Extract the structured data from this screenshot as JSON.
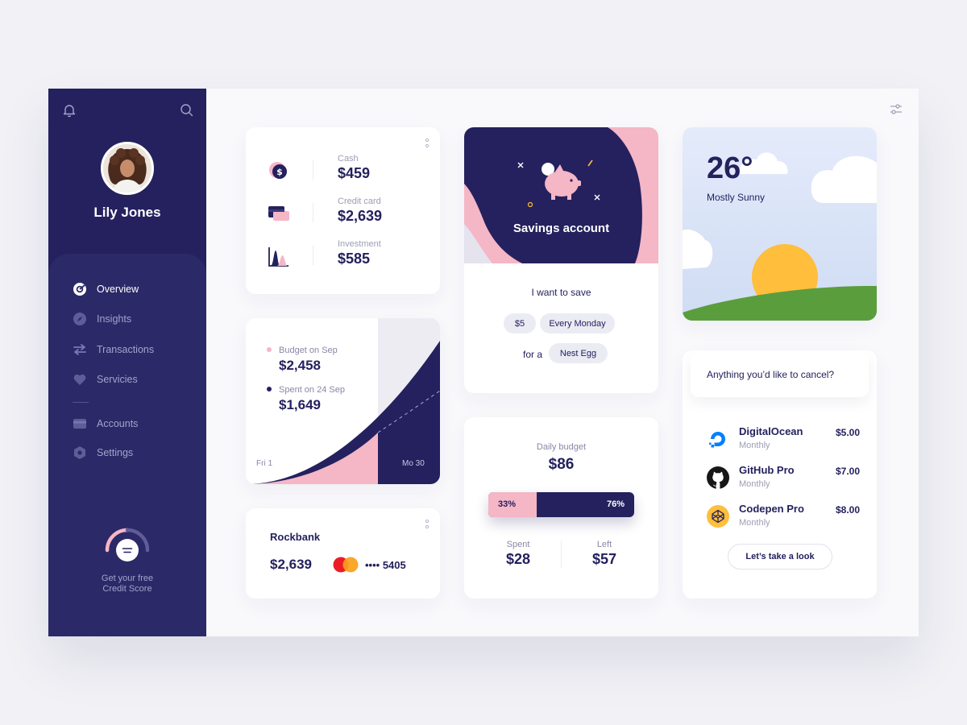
{
  "user": {
    "name": "Lily Jones"
  },
  "nav": {
    "items": [
      {
        "label": "Overview",
        "icon": "overview-icon",
        "active": true
      },
      {
        "label": "Insights",
        "icon": "compass-icon"
      },
      {
        "label": "Transactions",
        "icon": "transfer-icon"
      },
      {
        "label": "Servicies",
        "icon": "heart-icon"
      },
      {
        "label": "Accounts",
        "icon": "wallet-icon"
      },
      {
        "label": "Settings",
        "icon": "gear-icon"
      }
    ]
  },
  "credit_score": {
    "line1": "Get your free",
    "line2": "Credit Score"
  },
  "accounts": [
    {
      "label": "Cash",
      "value": "$459",
      "icon": "dollar-coin-icon"
    },
    {
      "label": "Credit card",
      "value": "$2,639",
      "icon": "credit-card-icon"
    },
    {
      "label": "Investment",
      "value": "$585",
      "icon": "investment-chart-icon"
    }
  ],
  "budget": {
    "budget_label": "Budget on Sep",
    "budget_value": "$2,458",
    "spent_label": "Spent on 24 Sep",
    "spent_value": "$1,649",
    "start_label": "Fri 1",
    "end_label": "Mo 30"
  },
  "rockbank": {
    "name": "Rockbank",
    "balance": "$2,639",
    "card_mask": "•••• 5405"
  },
  "savings": {
    "title": "Savings account",
    "want_text": "I want to save",
    "amount": "$5",
    "frequency": "Every Monday",
    "for_text": "for a",
    "goal": "Nest Egg"
  },
  "daily": {
    "label": "Daily budget",
    "value": "$86",
    "spent_percent": 33,
    "left_percent": 76,
    "spent_pct_label": "33%",
    "left_pct_label": "76%",
    "spent_label": "Spent",
    "spent_value": "$28",
    "left_label": "Left",
    "left_value": "$57"
  },
  "weather": {
    "temp": "26°",
    "desc": "Mostly Sunny"
  },
  "cancel": {
    "prompt": "Anything you’d like to cancel?",
    "subscriptions": [
      {
        "name": "DigitalOcean",
        "freq": "Monthly",
        "price": "$5.00",
        "icon": "digitalocean-icon"
      },
      {
        "name": "GitHub Pro",
        "freq": "Monthly",
        "price": "$7.00",
        "icon": "github-icon"
      },
      {
        "name": "Codepen Pro",
        "freq": "Monthly",
        "price": "$8.00",
        "icon": "codepen-icon"
      }
    ],
    "button": "Let’s take a look"
  },
  "colors": {
    "primary": "#24215e",
    "pink": "#f5b6c6",
    "sun": "#ffbe3b",
    "grass": "#5a9d3d"
  }
}
